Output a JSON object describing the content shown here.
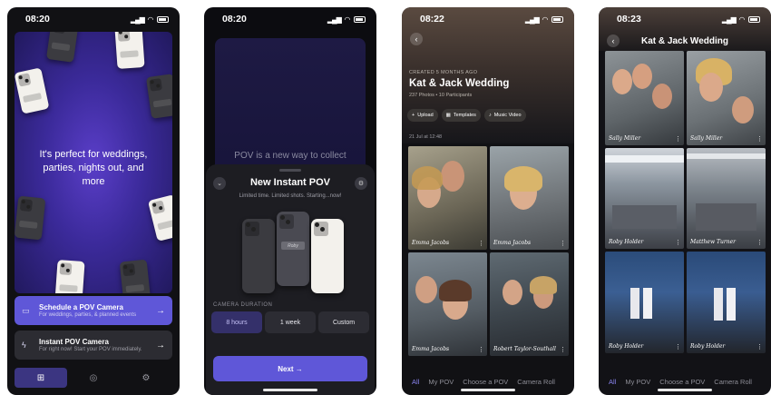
{
  "status_times": [
    "08:20",
    "08:20",
    "08:22",
    "08:23"
  ],
  "screen1": {
    "tagline": "It's perfect for weddings, parties, nights out, and more",
    "options": [
      {
        "title": "Schedule a POV Camera",
        "subtitle": "For weddings, parties, & planned events"
      },
      {
        "title": "Instant POV Camera",
        "subtitle": "For right now! Start your POV immediately."
      }
    ]
  },
  "screen2": {
    "background_text": "POV is a new way to collect",
    "sheet_title": "New Instant POV",
    "sheet_subtitle": "Limited time. Limited shots. Starting...now!",
    "phone_tag": "Roby",
    "duration_label": "CAMERA DURATION",
    "durations": [
      "8 hours",
      "1 week",
      "Custom"
    ],
    "selected_duration": "8 hours",
    "next_label": "Next →"
  },
  "screen3": {
    "meta": "CREATED 5 MONTHS AGO",
    "title": "Kat & Jack Wedding",
    "counts": "237 Photos • 10 Participants",
    "actions": [
      {
        "icon": "plus-icon",
        "label": "Upload"
      },
      {
        "icon": "templates-icon",
        "label": "Templates"
      },
      {
        "icon": "music-icon",
        "label": "Music Video"
      }
    ],
    "date": "21 Jul at 12:48",
    "photos": [
      "Emma Jacobs",
      "Emma Jacobs",
      "Emma Jacobs",
      "Robert Taylor-Southall"
    ],
    "tabs": [
      "All",
      "My POV",
      "Choose a POV",
      "Camera Roll"
    ]
  },
  "screen4": {
    "title": "Kat & Jack Wedding",
    "photos": [
      "Sally Miller",
      "Sally Miller",
      "Roby Holder",
      "Matthew Turner",
      "Roby Holder",
      "Roby Holder"
    ],
    "tabs": [
      "All",
      "My POV",
      "Choose a POV",
      "Camera Roll"
    ]
  },
  "colors": {
    "accent": "#5f57d8",
    "active_tab": "#8a84f0"
  }
}
